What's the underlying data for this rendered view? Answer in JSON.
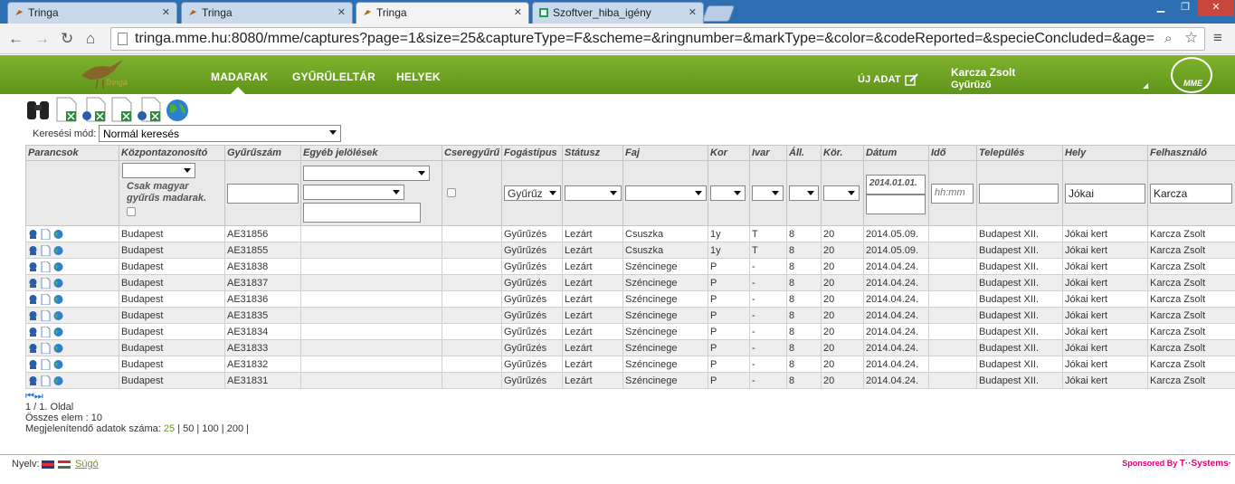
{
  "browser": {
    "tabs": [
      {
        "label": "Tringa",
        "active": false
      },
      {
        "label": "Tringa",
        "active": false
      },
      {
        "label": "Tringa",
        "active": true
      },
      {
        "label": "Szoftver_hiba_igény",
        "active": false
      }
    ],
    "url": "tringa.mme.hu:8080/mme/captures?page=1&size=25&captureType=F&scheme=&ringnumber=&markType=&color=&codeReported=&specieConcluded=&age="
  },
  "header": {
    "logo_text": "Tringa",
    "nav": [
      "MADARAK",
      "GYŰRŰLELTÁR",
      "HELYEK"
    ],
    "new_data": "ÚJ ADAT",
    "user_name": "Karcza Zsolt",
    "user_role": "Gyűrűző",
    "mme_logo": "MME"
  },
  "search_mode": {
    "label": "Keresési mód:",
    "value": "Normál keresés"
  },
  "table": {
    "headers": [
      "Parancsok",
      "Központazonosító",
      "Gyűrűszám",
      "Egyéb jelölések",
      "Cseregyűrű",
      "Fogástípus",
      "Státusz",
      "Faj",
      "Kor",
      "Ivar",
      "Áll.",
      "Kör.",
      "Dátum",
      "Idő",
      "Település",
      "Hely",
      "Felhasználó"
    ],
    "filters": {
      "hungarian_only_label": "Csak magyar gyűrűs madarak.",
      "capture_type": "Gyűrűz",
      "date_from": "2014.01.01.",
      "time_placeholder": "hh:mm",
      "place": "Jókai",
      "user": "Karcza"
    },
    "rows": [
      [
        "Budapest",
        "AE31856",
        "",
        "",
        "Gyűrűzés",
        "Lezárt",
        "Csuszka",
        "1y",
        "T",
        "8",
        "20",
        "2014.05.09.",
        "",
        "Budapest XII.",
        "Jókai kert",
        "Karcza Zsolt"
      ],
      [
        "Budapest",
        "AE31855",
        "",
        "",
        "Gyűrűzés",
        "Lezárt",
        "Csuszka",
        "1y",
        "T",
        "8",
        "20",
        "2014.05.09.",
        "",
        "Budapest XII.",
        "Jókai kert",
        "Karcza Zsolt"
      ],
      [
        "Budapest",
        "AE31838",
        "",
        "",
        "Gyűrűzés",
        "Lezárt",
        "Széncinege",
        "P",
        "-",
        "8",
        "20",
        "2014.04.24.",
        "",
        "Budapest XII.",
        "Jókai kert",
        "Karcza Zsolt"
      ],
      [
        "Budapest",
        "AE31837",
        "",
        "",
        "Gyűrűzés",
        "Lezárt",
        "Széncinege",
        "P",
        "-",
        "8",
        "20",
        "2014.04.24.",
        "",
        "Budapest XII.",
        "Jókai kert",
        "Karcza Zsolt"
      ],
      [
        "Budapest",
        "AE31836",
        "",
        "",
        "Gyűrűzés",
        "Lezárt",
        "Széncinege",
        "P",
        "-",
        "8",
        "20",
        "2014.04.24.",
        "",
        "Budapest XII.",
        "Jókai kert",
        "Karcza Zsolt"
      ],
      [
        "Budapest",
        "AE31835",
        "",
        "",
        "Gyűrűzés",
        "Lezárt",
        "Széncinege",
        "P",
        "-",
        "8",
        "20",
        "2014.04.24.",
        "",
        "Budapest XII.",
        "Jókai kert",
        "Karcza Zsolt"
      ],
      [
        "Budapest",
        "AE31834",
        "",
        "",
        "Gyűrűzés",
        "Lezárt",
        "Széncinege",
        "P",
        "-",
        "8",
        "20",
        "2014.04.24.",
        "",
        "Budapest XII.",
        "Jókai kert",
        "Karcza Zsolt"
      ],
      [
        "Budapest",
        "AE31833",
        "",
        "",
        "Gyűrűzés",
        "Lezárt",
        "Széncinege",
        "P",
        "-",
        "8",
        "20",
        "2014.04.24.",
        "",
        "Budapest XII.",
        "Jókai kert",
        "Karcza Zsolt"
      ],
      [
        "Budapest",
        "AE31832",
        "",
        "",
        "Gyűrűzés",
        "Lezárt",
        "Széncinege",
        "P",
        "-",
        "8",
        "20",
        "2014.04.24.",
        "",
        "Budapest XII.",
        "Jókai kert",
        "Karcza Zsolt"
      ],
      [
        "Budapest",
        "AE31831",
        "",
        "",
        "Gyűrűzés",
        "Lezárt",
        "Széncinege",
        "P",
        "-",
        "8",
        "20",
        "2014.04.24.",
        "",
        "Budapest XII.",
        "Jókai kert",
        "Karcza Zsolt"
      ]
    ]
  },
  "pager": {
    "page": "1 / 1. Oldal",
    "total": "Összes elem : 10",
    "size_label": "Megjelenítendő adatok száma:",
    "sizes": [
      "25",
      "50",
      "100",
      "200"
    ]
  },
  "footer": {
    "language_label": "Nyelv:",
    "help": "Súgó",
    "sponsor": "Sponsored By",
    "sponsor_brand": "T··Systems·"
  },
  "colors": {
    "header_green": "#6ea326",
    "link_green": "#6a9a1f",
    "sponsor_magenta": "#e20074"
  }
}
